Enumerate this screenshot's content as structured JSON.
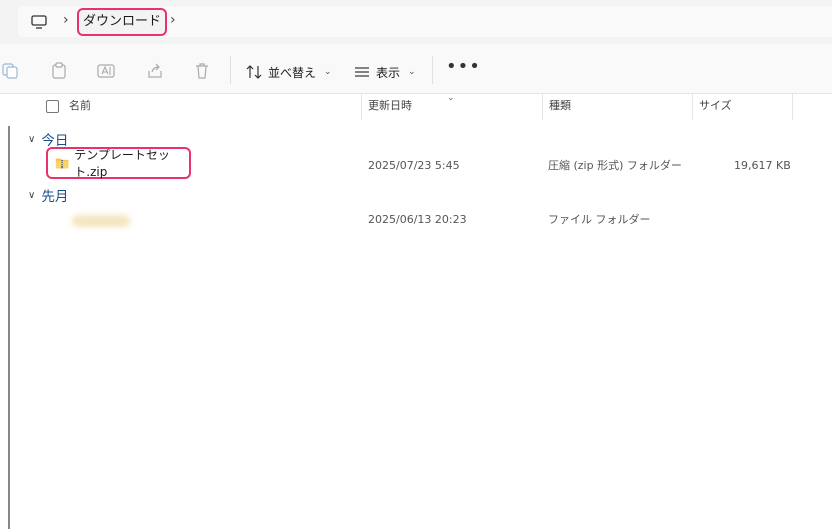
{
  "address_bar": {
    "pc_icon": "monitor-icon",
    "separator": "›",
    "crumb": "ダウンロード"
  },
  "toolbar": {
    "sort_label": "並べ替え",
    "view_label": "表示",
    "more_label": "•••"
  },
  "columns": {
    "name": "名前",
    "modified": "更新日時",
    "type": "種類",
    "size": "サイズ"
  },
  "groups": [
    {
      "label": "今日",
      "items": [
        {
          "name": "テンプレートセット.zip",
          "modified": "2025/07/23 5:45",
          "type": "圧縮 (zip 形式) フォルダー",
          "size": "19,617 KB"
        }
      ]
    },
    {
      "label": "先月",
      "items": [
        {
          "name": "",
          "modified": "2025/06/13 20:23",
          "type": "ファイル フォルダー",
          "size": ""
        }
      ]
    }
  ],
  "colors": {
    "highlight": "#e8336a",
    "group_text": "#1a4e8a"
  }
}
